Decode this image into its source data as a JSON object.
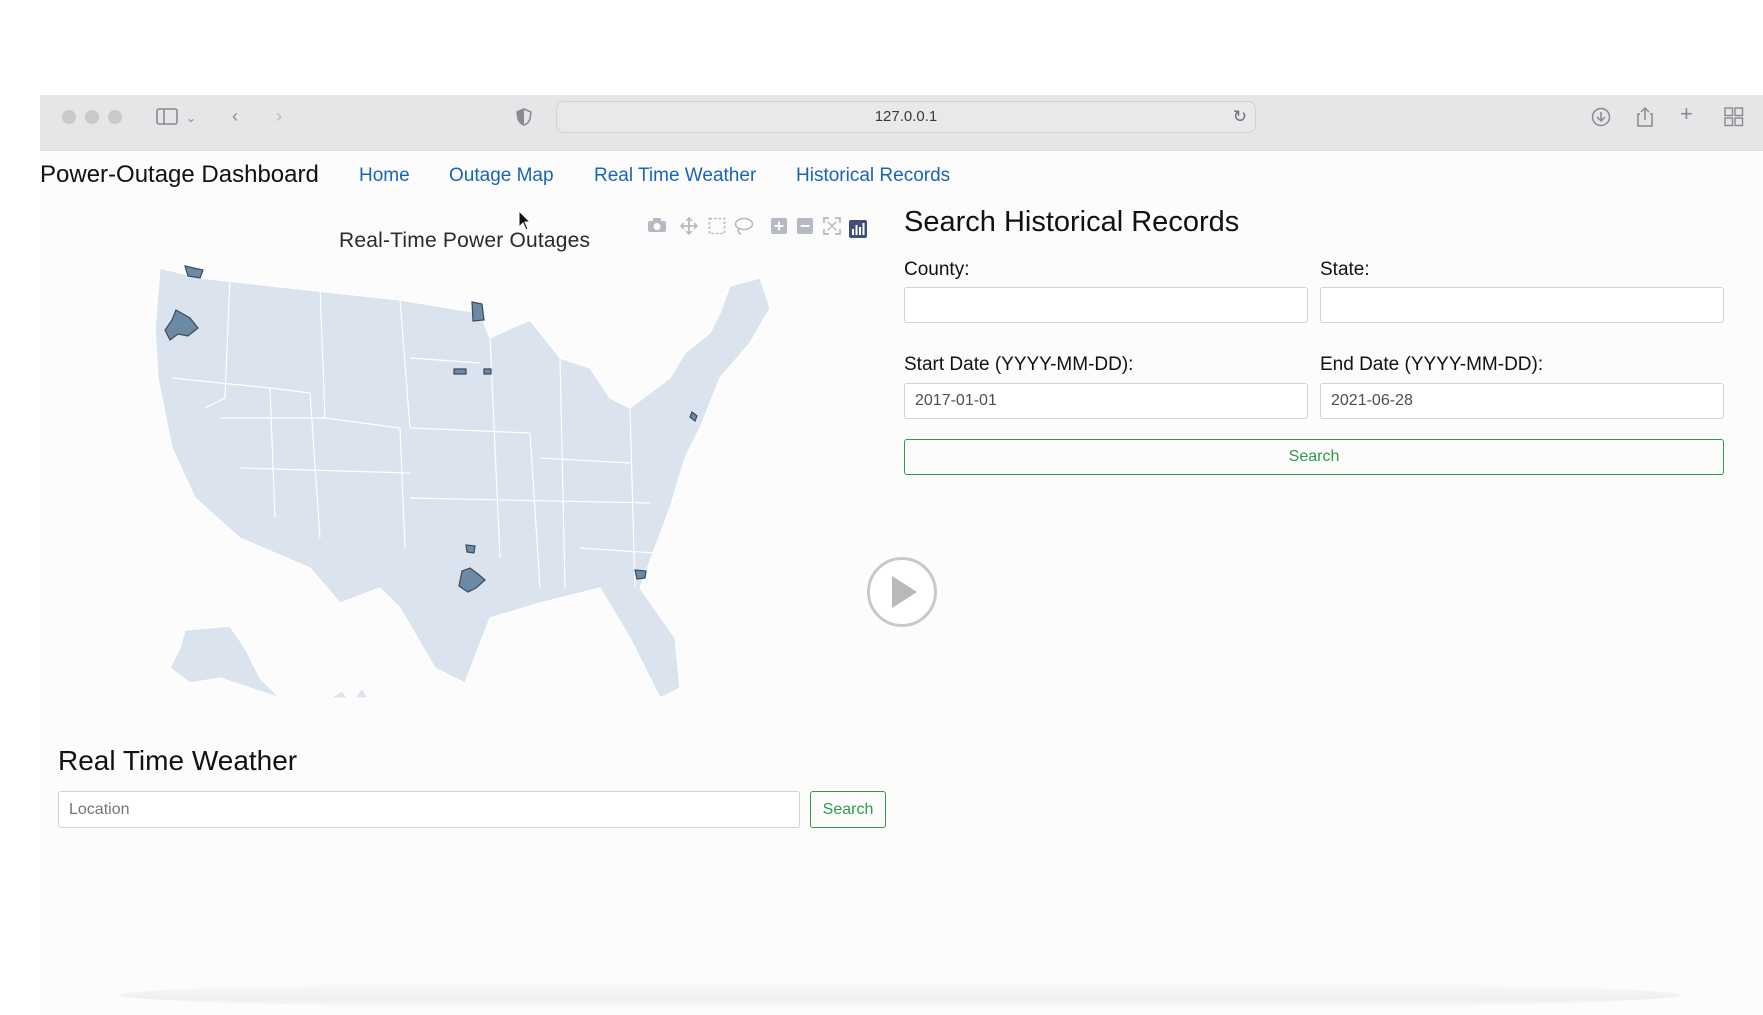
{
  "browser": {
    "url": "127.0.0.1",
    "icons": [
      "sidebar-icon",
      "chevron-down-icon",
      "back-icon",
      "forward-icon",
      "shield-icon",
      "reload-icon",
      "download-icon",
      "share-icon",
      "new-tab-icon",
      "tab-overview-icon"
    ]
  },
  "nav": {
    "brand": "Power-Outage Dashboard",
    "links": [
      "Home",
      "Outage Map",
      "Real Time Weather",
      "Historical Records"
    ]
  },
  "map": {
    "title": "Real-Time Power Outages",
    "modebar_icons": [
      "camera-icon",
      "pan-icon",
      "box-select-icon",
      "lasso-icon",
      "zoom-in-icon",
      "zoom-out-icon",
      "reset-axes-icon",
      "plotly-logo-icon"
    ],
    "colors": {
      "land": "#dbe3ee",
      "outage": "#6c8aa6",
      "border": "#ffffff"
    }
  },
  "historical": {
    "heading": "Search Historical Records",
    "county_label": "County:",
    "county_value": "",
    "state_label": "State:",
    "state_value": "",
    "start_label": "Start Date (YYYY-MM-DD):",
    "start_value": "2017-01-01",
    "end_label": "End Date (YYYY-MM-DD):",
    "end_value": "2021-06-28",
    "search_label": "Search"
  },
  "weather": {
    "heading": "Real Time Weather",
    "location_placeholder": "Location",
    "search_label": "Search"
  },
  "colors": {
    "accent_green": "#2c9d4b",
    "link_blue": "#1a64b8"
  }
}
